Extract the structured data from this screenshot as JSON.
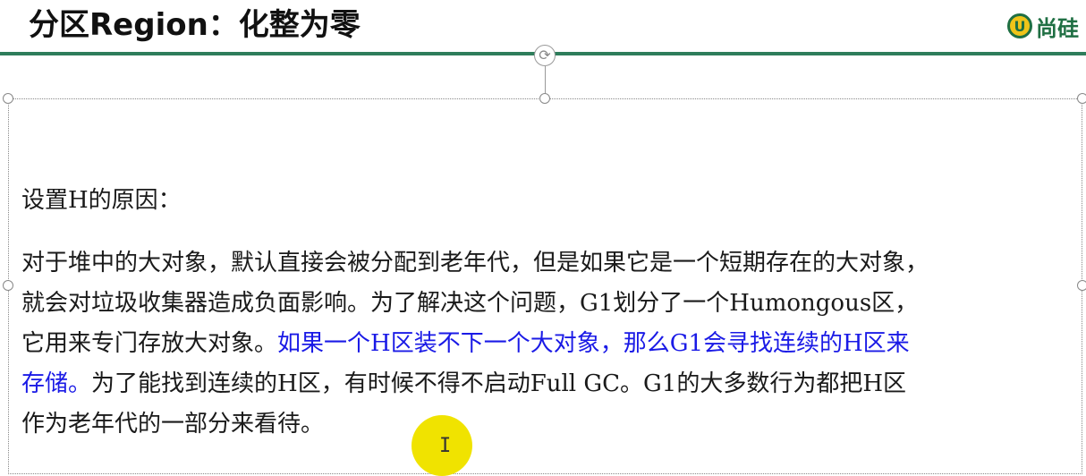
{
  "slide": {
    "title": "分区Region：化整为零"
  },
  "logo": {
    "mark": "U",
    "text": "尚硅"
  },
  "content": {
    "heading": "设置H的原因：",
    "lines": [
      {
        "normal": "对于堆中的大对象，默认直接会被分配到老年代，但是如果它是一个短期存在的大对象，",
        "blue": ""
      },
      {
        "normal": "就会对垃圾收集器造成负面影响。为了解决这个问题，G1划分了一个Humongous区，",
        "blue": ""
      },
      {
        "normal": "它用来专门存放大对象。",
        "blue": "如果一个H区装不下一个大对象，那么G1会寻找连续的H区来"
      },
      {
        "blue": "存储。",
        "normal": "为了能找到连续的H区，有时候不得不启动Full GC。G1的大多数行为都把H区"
      },
      {
        "normal": "作为老年代的一部分来看待。",
        "blue": ""
      }
    ]
  },
  "cursor": {
    "glyph": "I"
  },
  "colors": {
    "accent": "#2e7d5b",
    "highlight_text": "#1a1ae6",
    "cursor_highlight": "#f0e300"
  }
}
